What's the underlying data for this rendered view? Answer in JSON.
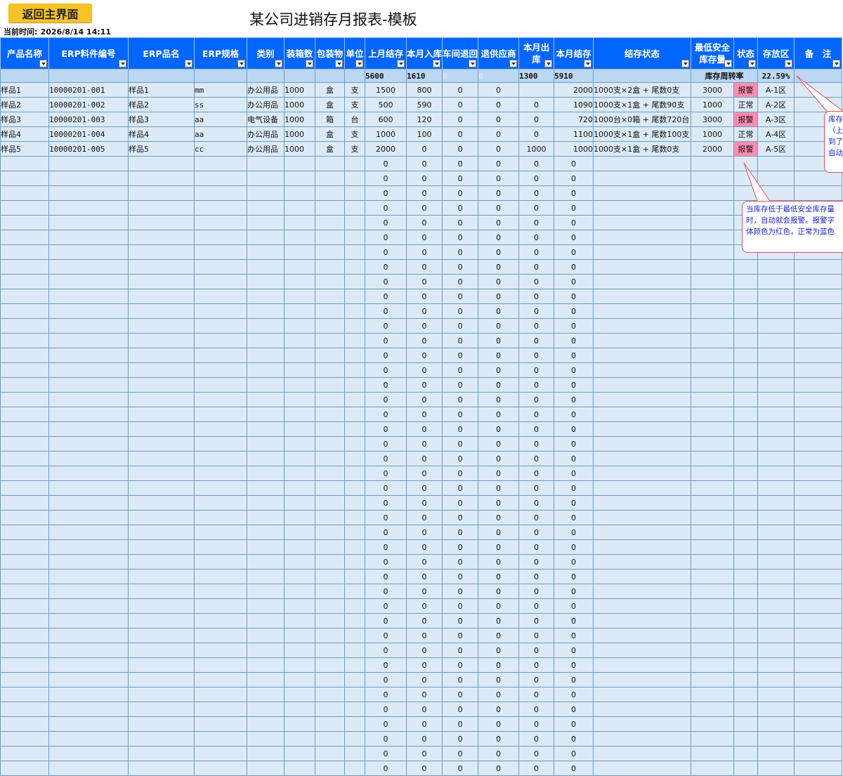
{
  "toolbar": {
    "home_button": "返回主界面"
  },
  "time": {
    "label": "当前时间:",
    "value": "2026/8/14 14:11"
  },
  "title": "某公司进销存月报表-模板",
  "columns": [
    "产品名称",
    "ERP料件编号",
    "ERP品名",
    "ERP规格",
    "类别",
    "装箱数",
    "包装物",
    "单位",
    "上月结存",
    "本月入库",
    "车间退回",
    "退供应商",
    "本月出库",
    "本月结存",
    "结存状态",
    "最低安全库存量",
    "状态",
    "存放区",
    "备　注"
  ],
  "summary": {
    "last_stock": "5600",
    "in": "1610",
    "return_in": "0",
    "return_out": "0",
    "out": "1300",
    "stock": "5910",
    "turnover_label": "库存周转率",
    "turnover": "22.59%"
  },
  "rows": [
    {
      "name": "样品1",
      "erp_no": "10000201-001",
      "erp_name": "样品1",
      "spec": "mm",
      "category": "办公用品",
      "box": "1000",
      "pack": "盒",
      "unit": "支",
      "last": "1500",
      "in": "800",
      "ret_in": "0",
      "ret_out": "0",
      "out": "",
      "stock": "2000",
      "state": "1000支×2盒 + 尾数0支",
      "min": "3000",
      "status": "报警",
      "area": "A-1区",
      "alarm": true
    },
    {
      "name": "样品2",
      "erp_no": "10000201-002",
      "erp_name": "样品2",
      "spec": "ss",
      "category": "办公用品",
      "box": "1000",
      "pack": "盒",
      "unit": "支",
      "last": "500",
      "in": "590",
      "ret_in": "0",
      "ret_out": "0",
      "out": "0",
      "stock": "1090",
      "state": "1000支×1盒 + 尾数90支",
      "min": "1000",
      "status": "正常",
      "area": "A-2区",
      "alarm": false
    },
    {
      "name": "样品3",
      "erp_no": "10000201-003",
      "erp_name": "样品3",
      "spec": "aa",
      "category": "电气设备",
      "box": "1000",
      "pack": "箱",
      "unit": "台",
      "last": "600",
      "in": "120",
      "ret_in": "0",
      "ret_out": "0",
      "out": "0",
      "stock": "720",
      "state": "1000台×0箱 + 尾数720台",
      "min": "3000",
      "status": "报警",
      "area": "A-3区",
      "alarm": true
    },
    {
      "name": "样品4",
      "erp_no": "10000201-004",
      "erp_name": "样品4",
      "spec": "aa",
      "category": "办公用品",
      "box": "1000",
      "pack": "盒",
      "unit": "支",
      "last": "1000",
      "in": "100",
      "ret_in": "0",
      "ret_out": "0",
      "out": "0",
      "stock": "1100",
      "state": "1000支×1盒 + 尾数100支",
      "min": "1000",
      "status": "正常",
      "area": "A-4区",
      "alarm": false
    },
    {
      "name": "样品5",
      "erp_no": "10000201-005",
      "erp_name": "样品5",
      "spec": "cc",
      "category": "办公用品",
      "box": "1000",
      "pack": "盒",
      "unit": "支",
      "last": "2000",
      "in": "0",
      "ret_in": "0",
      "ret_out": "0",
      "out": "1000",
      "stock": "1000",
      "state": "1000支×1盒 + 尾数0支",
      "min": "2000",
      "status": "报警",
      "area": "A-5区",
      "alarm": true
    }
  ],
  "empty_row_value": "0",
  "callouts": {
    "top_lines": [
      "库存",
      "（上",
      "到了",
      "自动"
    ],
    "bottom_lines": [
      "当库存低于最低安全库存量",
      "时，自动就会报警。报警字",
      "体颜色为红色，正常为蓝色"
    ]
  },
  "colors": {
    "header_bg": "#0066ff",
    "alarm_bg": "#ff8db0",
    "alarm_text": "#d8002a",
    "ok_text": "#0047ff",
    "button_bg": "#f5c227"
  }
}
